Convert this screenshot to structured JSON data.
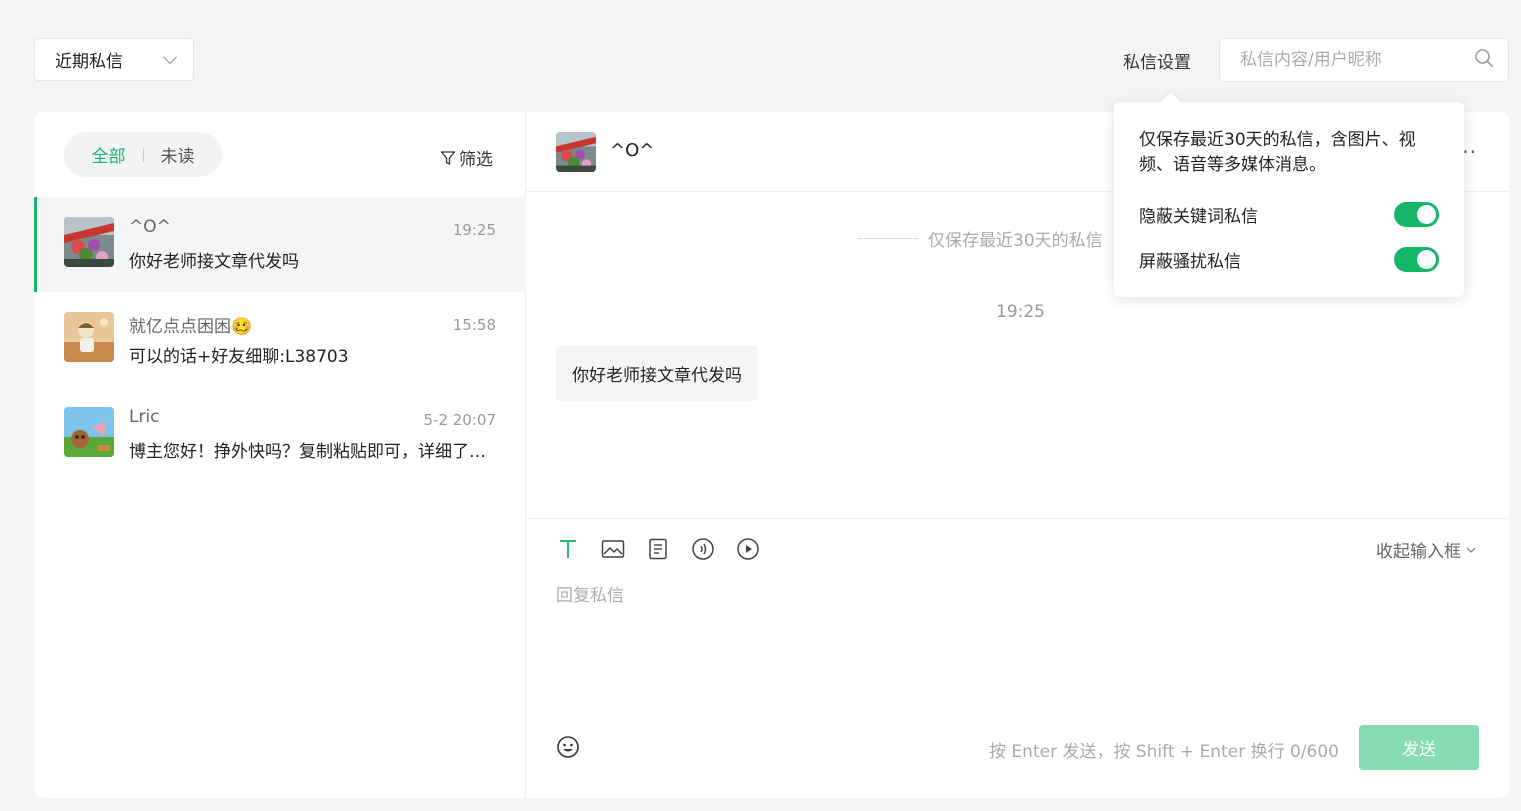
{
  "top_bar": {
    "select_value": "近期私信",
    "settings_label": "私信设置",
    "search_placeholder": "私信内容/用户昵称"
  },
  "settings_popover": {
    "description": "仅保存最近30天的私信，含图片、视频、语音等多媒体消息。",
    "options": [
      {
        "label": "隐蔽关键词私信",
        "enabled": true
      },
      {
        "label": "屏蔽骚扰私信",
        "enabled": true
      }
    ]
  },
  "sidebar": {
    "tabs": [
      {
        "label": "全部",
        "active": true
      },
      {
        "label": "未读",
        "active": false
      }
    ],
    "filter_label": "筛选",
    "conversations": [
      {
        "name": "^O^",
        "time": "19:25",
        "preview": "你好老师接文章代发吗",
        "active": true
      },
      {
        "name": "就亿点点困困🥴",
        "time": "15:58",
        "preview": "可以的话+好友细聊:L38703",
        "active": false
      },
      {
        "name": "Lric",
        "time": "5-2 20:07",
        "preview": "博主您好！挣外快吗？复制粘贴即可，详细了解请加好友",
        "active": false
      }
    ]
  },
  "chat": {
    "header_name": "^O^",
    "notice": "仅保存最近30天的私信",
    "message_time": "19:25",
    "messages": [
      {
        "text": "你好老师接文章代发吗"
      }
    ],
    "collapse_label": "收起输入框",
    "reply_placeholder": "回复私信",
    "hint": "按 Enter 发送，按 Shift + Enter 换行  0/600",
    "send_label": "发送"
  },
  "colors": {
    "accent": "#15b56a",
    "send_disabled": "#86dcb2",
    "background": "#f4f5f7"
  }
}
